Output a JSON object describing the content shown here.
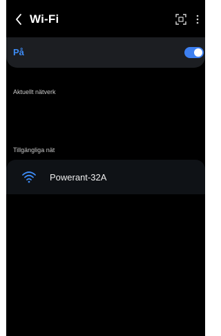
{
  "header": {
    "title": "Wi-Fi",
    "back_icon": "chevron-left-icon",
    "scan_icon": "qr-scan-icon",
    "more_icon": "more-vertical-icon"
  },
  "wifi_toggle": {
    "label": "På",
    "state": "on",
    "accent_color": "#3d8bf5"
  },
  "sections": {
    "current_network": "Aktuellt nätverk",
    "available_networks": "Tillgängliga nät"
  },
  "networks": [
    {
      "name": "Powerant-32A",
      "icon": "wifi-icon"
    }
  ]
}
